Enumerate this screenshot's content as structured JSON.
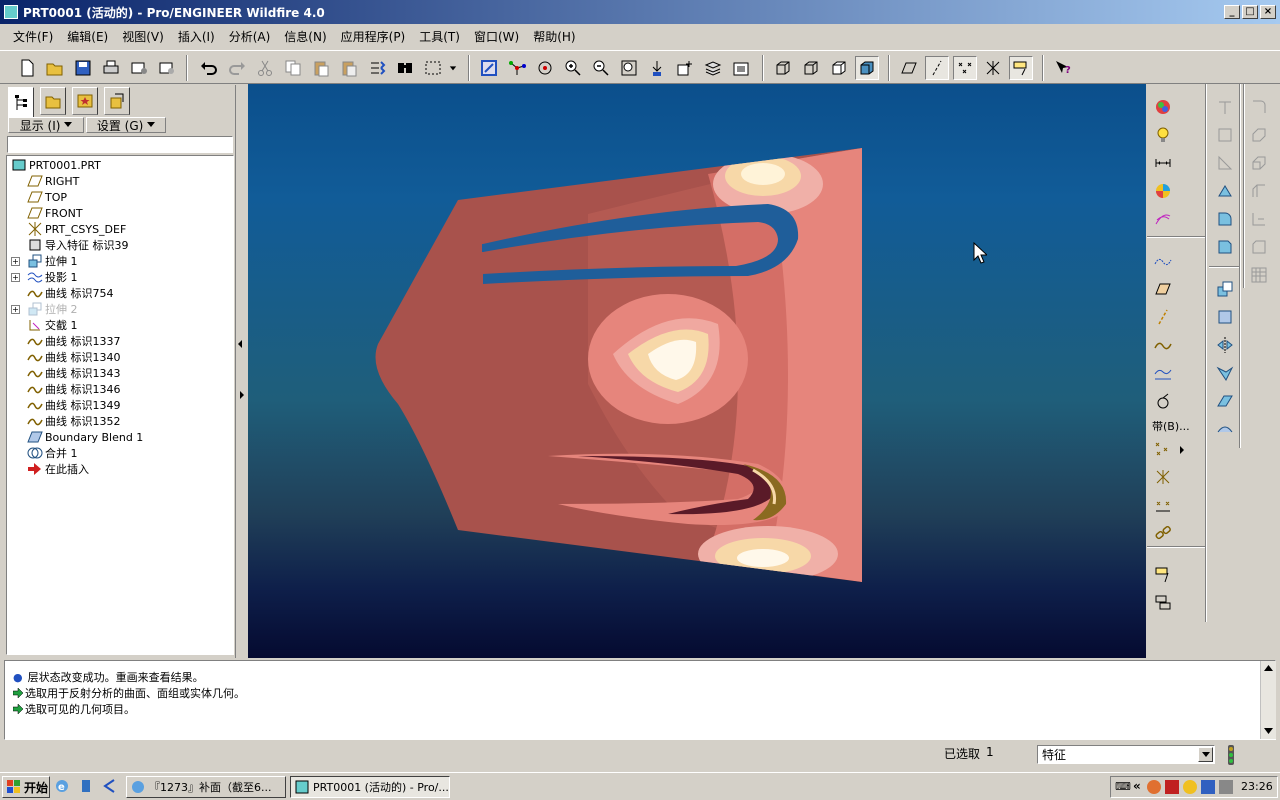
{
  "window": {
    "title": "PRT0001 (活动的) - Pro/ENGINEER Wildfire 4.0"
  },
  "menu": [
    "文件(F)",
    "编辑(E)",
    "视图(V)",
    "插入(I)",
    "分析(A)",
    "信息(N)",
    "应用程序(P)",
    "工具(T)",
    "窗口(W)",
    "帮助(H)"
  ],
  "left_panel": {
    "show_label": "显示 (I)",
    "settings_label": "设置 (G)",
    "tree": [
      {
        "label": "PRT0001.PRT",
        "icon": "part-icon",
        "indent": 0,
        "expand": false
      },
      {
        "label": "RIGHT",
        "icon": "datum-plane-icon",
        "indent": 1,
        "expand": false
      },
      {
        "label": "TOP",
        "icon": "datum-plane-icon",
        "indent": 1,
        "expand": false
      },
      {
        "label": "FRONT",
        "icon": "datum-plane-icon",
        "indent": 1,
        "expand": false
      },
      {
        "label": "PRT_CSYS_DEF",
        "icon": "csys-icon",
        "indent": 1,
        "expand": false
      },
      {
        "label": "导入特征 标识39",
        "icon": "import-feature-icon",
        "indent": 1,
        "expand": false
      },
      {
        "label": "拉伸 1",
        "icon": "extrude-icon",
        "indent": 1,
        "expand": true
      },
      {
        "label": "投影 1",
        "icon": "projection-icon",
        "indent": 1,
        "expand": true
      },
      {
        "label": "曲线 标识754",
        "icon": "curve-icon",
        "indent": 1,
        "expand": false
      },
      {
        "label": "拉伸 2",
        "icon": "extrude-icon",
        "indent": 1,
        "expand": true,
        "faded": true
      },
      {
        "label": "交截 1",
        "icon": "intersect-icon",
        "indent": 1,
        "expand": false
      },
      {
        "label": "曲线 标识1337",
        "icon": "curve-icon",
        "indent": 1,
        "expand": false
      },
      {
        "label": "曲线 标识1340",
        "icon": "curve-icon",
        "indent": 1,
        "expand": false
      },
      {
        "label": "曲线 标识1343",
        "icon": "curve-icon",
        "indent": 1,
        "expand": false
      },
      {
        "label": "曲线 标识1346",
        "icon": "curve-icon",
        "indent": 1,
        "expand": false
      },
      {
        "label": "曲线 标识1349",
        "icon": "curve-icon",
        "indent": 1,
        "expand": false
      },
      {
        "label": "曲线 标识1352",
        "icon": "curve-icon",
        "indent": 1,
        "expand": false
      },
      {
        "label": "Boundary Blend 1",
        "icon": "boundary-blend-icon",
        "indent": 1,
        "expand": false
      },
      {
        "label": "合并 1",
        "icon": "merge-icon",
        "indent": 1,
        "expand": false
      },
      {
        "label": "在此插入",
        "icon": "insert-here-arrow-icon",
        "indent": 1,
        "expand": false
      }
    ]
  },
  "right_toolbar": {
    "band_label": "带(B)..."
  },
  "messages": [
    "层状态改变成功。重画来查看结果。",
    "选取用于反射分析的曲面、面组或实体几何。",
    "选取可见的几何项目。"
  ],
  "status": {
    "selected_label": "已选取",
    "selected_count": "1",
    "filter_value": "特征"
  },
  "taskbar": {
    "start_label": "开始",
    "buttons": [
      "『1273』补面（截至6...",
      "PRT0001 (活动的) - Pro/..."
    ],
    "clock": "23:26"
  },
  "colors": {
    "surface": "#a8524c",
    "highlight": "#fff2c8",
    "viewport_top": "#0b4f8c",
    "viewport_bottom": "#050a30"
  }
}
